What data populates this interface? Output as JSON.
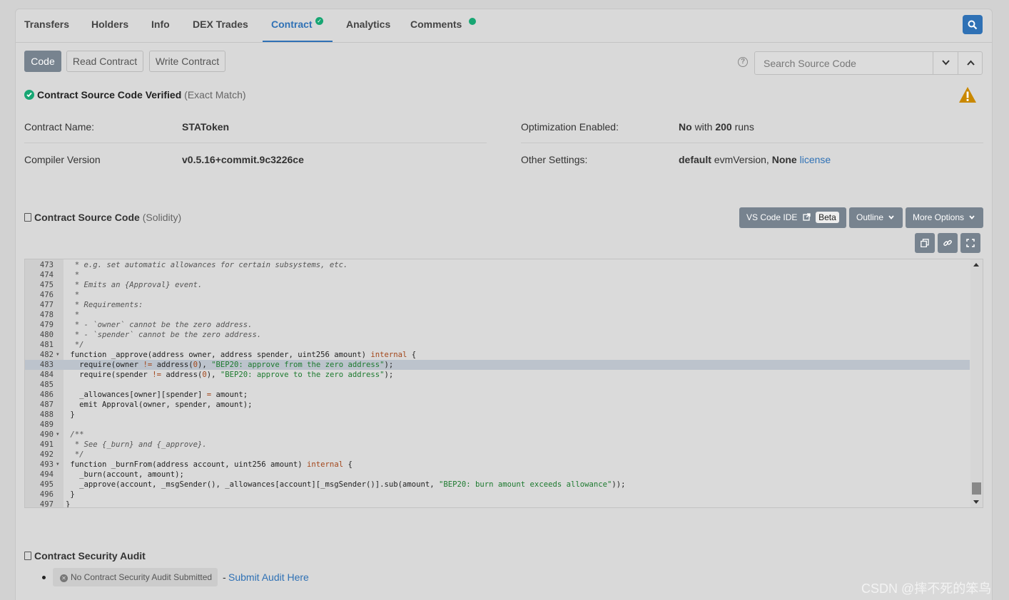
{
  "tabs": [
    {
      "label": "Transfers"
    },
    {
      "label": "Holders"
    },
    {
      "label": "Info"
    },
    {
      "label": "DEX Trades"
    },
    {
      "label": "Contract"
    },
    {
      "label": "Analytics"
    },
    {
      "label": "Comments"
    }
  ],
  "subtabs": {
    "code": "Code",
    "read": "Read Contract",
    "write": "Write Contract"
  },
  "search": {
    "placeholder": "Search Source Code",
    "help": "?"
  },
  "verified": {
    "title": "Contract Source Code Verified",
    "match": "(Exact Match)"
  },
  "info": {
    "name_label": "Contract Name:",
    "name_value": "STAToken",
    "compiler_label": "Compiler Version",
    "compiler_value": "v0.5.16+commit.9c3226ce",
    "opt_label": "Optimization Enabled:",
    "opt_value_bold": "No",
    "opt_with": "with",
    "opt_runs_bold": "200",
    "opt_runs": "runs",
    "other_label": "Other Settings:",
    "other_default": "default",
    "other_evm": "evmVersion,",
    "other_none": "None",
    "other_license": "license"
  },
  "source": {
    "title": "Contract Source Code",
    "lang": "(Solidity)",
    "vscode": "VS Code IDE",
    "beta": "Beta",
    "outline": "Outline",
    "more": "More Options"
  },
  "code_lines": [
    {
      "n": "473",
      "t": "  * e.g. set automatic allowances for certain subsystems, etc."
    },
    {
      "n": "474",
      "t": "  *"
    },
    {
      "n": "475",
      "t": "  * Emits an {Approval} event."
    },
    {
      "n": "476",
      "t": "  *"
    },
    {
      "n": "477",
      "t": "  * Requirements:"
    },
    {
      "n": "478",
      "t": "  *"
    },
    {
      "n": "479",
      "t": "  * - `owner` cannot be the zero address."
    },
    {
      "n": "480",
      "t": "  * - `spender` cannot be the zero address."
    },
    {
      "n": "481",
      "t": "  */"
    },
    {
      "n": "482",
      "t": " function _approve(address owner, address spender, uint256 amount) internal {"
    },
    {
      "n": "483",
      "t": "   require(owner != address(0), \"BEP20: approve from the zero address\");"
    },
    {
      "n": "484",
      "t": "   require(spender != address(0), \"BEP20: approve to the zero address\");"
    },
    {
      "n": "485",
      "t": ""
    },
    {
      "n": "486",
      "t": "   _allowances[owner][spender] = amount;"
    },
    {
      "n": "487",
      "t": "   emit Approval(owner, spender, amount);"
    },
    {
      "n": "488",
      "t": " }"
    },
    {
      "n": "489",
      "t": ""
    },
    {
      "n": "490",
      "t": " /**"
    },
    {
      "n": "491",
      "t": "  * See {_burn} and {_approve}."
    },
    {
      "n": "492",
      "t": "  */"
    },
    {
      "n": "493",
      "t": " function _burnFrom(address account, uint256 amount) internal {"
    },
    {
      "n": "494",
      "t": "   _burn(account, amount);"
    },
    {
      "n": "495",
      "t": "   _approve(account, _msgSender(), _allowances[account][_msgSender()].sub(amount, \"BEP20: burn amount exceeds allowance\"));"
    },
    {
      "n": "496",
      "t": " }"
    },
    {
      "n": "497",
      "t": "}"
    }
  ],
  "audit": {
    "title": "Contract Security Audit",
    "none": "No Contract Security Audit Submitted",
    "sep": "-",
    "submit": "Submit Audit Here"
  },
  "watermark": "CSDN @摔不死的笨鸟",
  "colors": {
    "accent": "#2f71b5",
    "success": "#17a673",
    "warning": "#c98800"
  }
}
